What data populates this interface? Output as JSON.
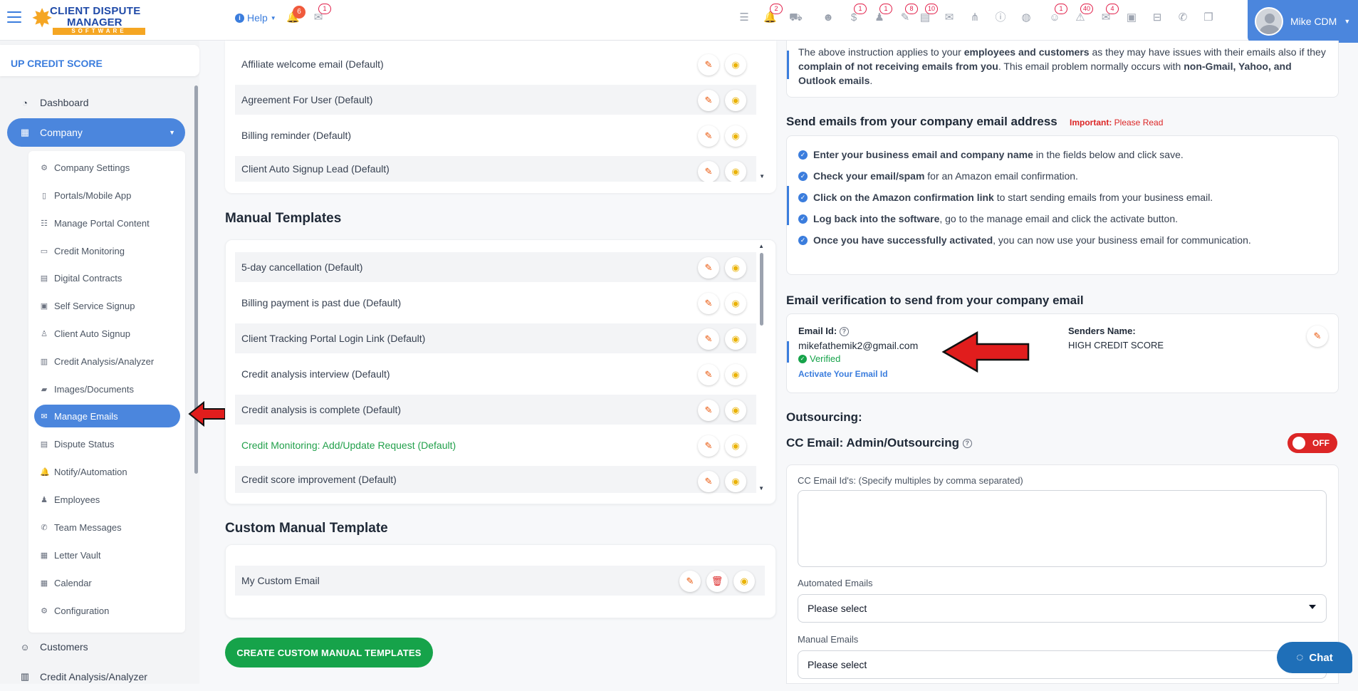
{
  "header": {
    "logo": {
      "line1": "CLIENT DISPUTE",
      "line2": "MANAGER",
      "line3": "SOFTWARE"
    },
    "help_label": "Help",
    "bell_badge": "6",
    "messages_badge": "1",
    "tool_badges": [
      "2",
      "1",
      "1",
      "8",
      "10",
      "1",
      "40",
      "4"
    ],
    "user_name": "Mike CDM"
  },
  "sidebar": {
    "org_name": "UP CREDIT SCORE",
    "items": [
      {
        "label": "Dashboard"
      },
      {
        "label": "Company"
      },
      {
        "label": "Customers"
      },
      {
        "label": "Credit Analysis/Analyzer"
      }
    ],
    "company_sub": [
      "Company Settings",
      "Portals/Mobile App",
      "Manage Portal Content",
      "Credit Monitoring",
      "Digital Contracts",
      "Self Service Signup",
      "Client Auto Signup",
      "Credit Analysis/Analyzer",
      "Images/Documents",
      "Manage Emails",
      "Dispute Status",
      "Notify/Automation",
      "Employees",
      "Team Messages",
      "Letter Vault",
      "Calendar",
      "Configuration"
    ]
  },
  "auto_templates": [
    "Affiliate welcome email (Default)",
    "Agreement For User (Default)",
    "Billing reminder (Default)",
    "Client Auto Signup Lead (Default)"
  ],
  "manual_title": "Manual Templates",
  "manual_templates": [
    "5-day cancellation (Default)",
    "Billing payment is past due (Default)",
    "Client Tracking Portal Login Link (Default)",
    "Credit analysis interview (Default)",
    "Credit analysis is complete (Default)",
    "Credit Monitoring: Add/Update Request (Default)",
    "Credit score improvement (Default)"
  ],
  "custom_title": "Custom Manual Template",
  "custom_templates": [
    "My Custom Email"
  ],
  "create_button": "CREATE CUSTOM MANUAL TEMPLATES",
  "right": {
    "info": {
      "t1": "The above instruction applies to your ",
      "b1": "employees and customers",
      "t2": " as they may have issues with their emails also if they ",
      "b2": "complain of not receiving emails from you",
      "t3": ". This email problem normally occurs with ",
      "b3": "non-Gmail, Yahoo, and Outlook emails",
      "t4": "."
    },
    "send_title": "Send emails from your company email address",
    "important_label": "Important:",
    "important_text": " Please Read",
    "steps": [
      {
        "b": "Enter your business email and company name",
        "t": " in the fields below and click save."
      },
      {
        "b": "Check your email/spam",
        "t": " for an Amazon email confirmation."
      },
      {
        "b": "Click on the Amazon confirmation link",
        "t": " to start sending emails from your business email."
      },
      {
        "b": "Log back into the software",
        "t": ", go to the manage email and click the activate button."
      },
      {
        "b": "Once you have successfully activated",
        "t": ", you can now use your business email for communication."
      }
    ],
    "verif_title": "Email verification to send from your company email",
    "email_id_label": "Email Id:",
    "email_value": "mikefathemik2@gmail.com",
    "verified": "Verified",
    "activate_link": "Activate Your Email Id",
    "senders_label": "Senders Name:",
    "senders_value": "HIGH CREDIT SCORE",
    "outsourcing_title": "Outsourcing:",
    "cc_title": "CC Email: Admin/Outsourcing",
    "toggle_label": "OFF",
    "cc_ids_label": "CC Email Id's: (Specify multiples by comma separated)",
    "automated_label": "Automated Emails",
    "automated_value": "Please select",
    "manual_label": "Manual Emails",
    "manual_value": "Please select"
  },
  "chat_label": "Chat"
}
